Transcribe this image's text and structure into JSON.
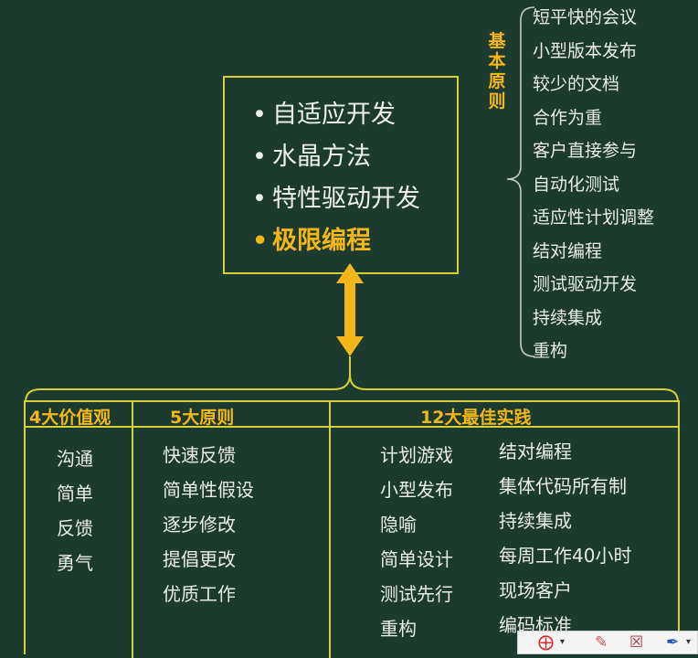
{
  "methods": [
    "自适应开发",
    "水晶方法",
    "特性驱动开发",
    "极限编程"
  ],
  "bullet": "•",
  "basic_principles": {
    "title": "基本原则",
    "items": [
      "短平快的会议",
      "小型版本发布",
      "较少的文档",
      "合作为重",
      "客户直接参与",
      "自动化测试",
      "适应性计划调整",
      "结对编程",
      "测试驱动开发",
      "持续集成",
      "重构"
    ]
  },
  "table": {
    "values": {
      "header": "4大价值观",
      "items": [
        "沟通",
        "简单",
        "反馈",
        "勇气"
      ]
    },
    "principles": {
      "header": "5大原则",
      "items": [
        "快速反馈",
        "简单性假设",
        "逐步修改",
        "提倡更改",
        "优质工作"
      ]
    },
    "practices": {
      "header": "12大最佳实践",
      "col1": [
        "计划游戏",
        "小型发布",
        "隐喻",
        "简单设计",
        "测试先行",
        "重构"
      ],
      "col2": [
        "结对编程",
        "集体代码所有制",
        "持续集成",
        "每周工作40小时",
        "现场客户",
        "编码标准"
      ]
    }
  },
  "toolbar": [
    "pointer-icon",
    "dropdown-arrow-icon",
    "eraser-icon",
    "clear-icon",
    "pen-icon",
    "dropdown-arrow-icon"
  ],
  "colors": {
    "background": "#1c3a2e",
    "border": "#d7cf3a",
    "highlight": "#f4b71b",
    "text": "#ececE6"
  }
}
